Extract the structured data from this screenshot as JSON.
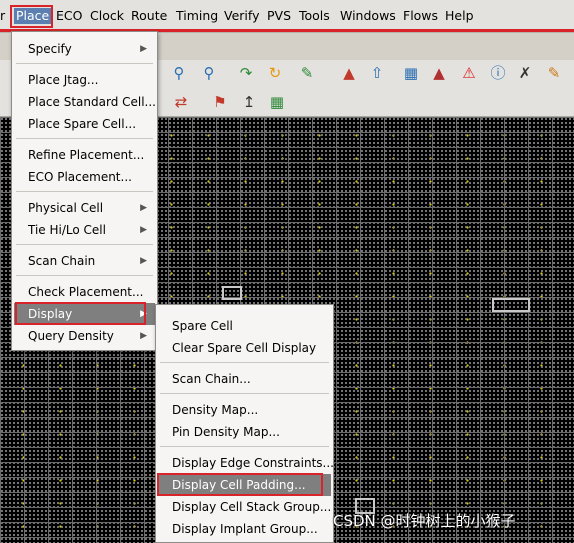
{
  "menubar": {
    "items": [
      "r",
      "Place",
      "ECO",
      "Clock",
      "Route",
      "Timing",
      "Verify",
      "PVS",
      "Tools",
      "Windows",
      "Flows",
      "Help"
    ]
  },
  "place_menu": {
    "items": [
      "Specify",
      "Place Jtag...",
      "Place Standard Cell...",
      "Place Spare Cell...",
      "Refine Placement...",
      "ECO Placement...",
      "Physical Cell",
      "Tie Hi/Lo Cell",
      "Scan Chain",
      "Check Placement...",
      "Display",
      "Query Density"
    ],
    "selected": "Display"
  },
  "display_submenu": {
    "items": [
      "Spare Cell",
      "Clear Spare Cell Display",
      "Scan Chain...",
      "Density Map...",
      "Pin Density Map...",
      "Display Edge Constraints...",
      "Display Cell Padding...",
      "Display Cell Stack Group...",
      "Display Implant Group..."
    ],
    "highlighted": "Display Cell Padding..."
  },
  "watermark": "CSDN @时钟树上的小猴子",
  "colors": {
    "annotation_red": "#d8232a",
    "menu_highlight": "#7f7f7f",
    "menubar_active": "#5c7fb1",
    "canvas": "#000000"
  },
  "toolbar_icons": [
    "zoom-in-icon",
    "zoom-select-icon",
    "redo-icon",
    "refresh-icon",
    "selection-icon",
    "hierarchy-icon",
    "layout-icon",
    "table-icon",
    "tree-icon",
    "warning-icon",
    "info-icon",
    "wire-icon",
    "ruler-icon",
    "route-arrow-icon",
    "flag-icon",
    "snap-icon",
    "grid-icon"
  ]
}
